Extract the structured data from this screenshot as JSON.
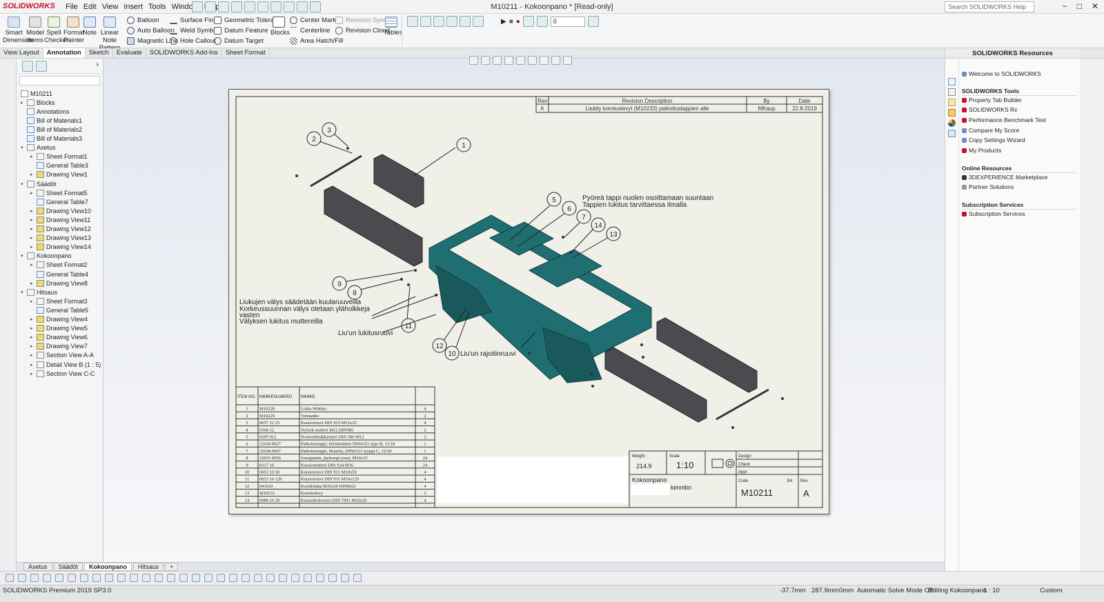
{
  "app": {
    "logo": "SOLIDWORKS",
    "menu": [
      "File",
      "Edit",
      "View",
      "Insert",
      "Tools",
      "Window",
      "Help"
    ],
    "title": "M10211 - Kokoonpano * [Read-only]",
    "search_placeholder": "Search SOLIDWORKS Help",
    "window_buttons": [
      "−",
      "□",
      "✕"
    ]
  },
  "ribbon": {
    "big": [
      {
        "label": "Smart Dimension",
        "icon": "smart-dimension-icon"
      },
      {
        "label": "Model Items",
        "icon": "model-items-icon"
      },
      {
        "label": "Spell Checker",
        "icon": "spell-checker-icon"
      },
      {
        "label": "Format Painter",
        "icon": "format-painter-icon"
      },
      {
        "label": "Note",
        "icon": "note-icon"
      },
      {
        "label": "Linear Note Pattern",
        "icon": "linear-note-pattern-icon"
      }
    ],
    "col1": [
      "Balloon",
      "Auto Balloon",
      "Magnetic Line"
    ],
    "col2": [
      "Surface Finish",
      "Weld Symbol",
      "Hole Callout"
    ],
    "col3": [
      "Geometric Tolerance",
      "Datum Feature",
      "Datum Target"
    ],
    "blocks": "Blocks",
    "col4": [
      "Center Mark",
      "Centerline",
      "Area Hatch/Fill"
    ],
    "col5": [
      "Revision Symbol",
      "Revision Cloud"
    ],
    "tables": "Tables",
    "layer_value": "0"
  },
  "tabs": [
    "View Layout",
    "Annotation",
    "Sketch",
    "Evaluate",
    "SOLIDWORKS Add-Ins",
    "Sheet Format"
  ],
  "active_tab": "Annotation",
  "tree": {
    "root": "M10211",
    "items": [
      {
        "label": "Blocks",
        "level": 1,
        "exp": "▸",
        "kind": "fold"
      },
      {
        "label": "Annotations",
        "level": 1,
        "exp": "",
        "kind": "ann"
      },
      {
        "label": "Bill of Materials1",
        "level": 1,
        "exp": "",
        "kind": "tbl"
      },
      {
        "label": "Bill of Materials2",
        "level": 1,
        "exp": "",
        "kind": "tbl"
      },
      {
        "label": "Bill of Materials3",
        "level": 1,
        "exp": "",
        "kind": "tbl"
      },
      {
        "label": "Asetus",
        "level": 1,
        "exp": "▾",
        "kind": "fold"
      },
      {
        "label": "Sheet Format1",
        "level": 2,
        "exp": "▸",
        "kind": "fold"
      },
      {
        "label": "General Table3",
        "level": 2,
        "exp": "",
        "kind": "tbl"
      },
      {
        "label": "Drawing View1",
        "level": 2,
        "exp": "▸",
        "kind": "view"
      },
      {
        "label": "Säädöt",
        "level": 1,
        "exp": "▾",
        "kind": "fold"
      },
      {
        "label": "Sheet Format5",
        "level": 2,
        "exp": "▸",
        "kind": "fold"
      },
      {
        "label": "General Table7",
        "level": 2,
        "exp": "",
        "kind": "tbl"
      },
      {
        "label": "Drawing View10",
        "level": 2,
        "exp": "▸",
        "kind": "view"
      },
      {
        "label": "Drawing View11",
        "level": 2,
        "exp": "▸",
        "kind": "view"
      },
      {
        "label": "Drawing View12",
        "level": 2,
        "exp": "▸",
        "kind": "view"
      },
      {
        "label": "Drawing View13",
        "level": 2,
        "exp": "▸",
        "kind": "view"
      },
      {
        "label": "Drawing View14",
        "level": 2,
        "exp": "▸",
        "kind": "view"
      },
      {
        "label": "Kokoonpano",
        "level": 1,
        "exp": "▾",
        "kind": "fold"
      },
      {
        "label": "Sheet Format2",
        "level": 2,
        "exp": "▸",
        "kind": "fold"
      },
      {
        "label": "General Table4",
        "level": 2,
        "exp": "",
        "kind": "tbl"
      },
      {
        "label": "Drawing View8",
        "level": 2,
        "exp": "▸",
        "kind": "view"
      },
      {
        "label": "Hitsaus",
        "level": 1,
        "exp": "▾",
        "kind": "fold"
      },
      {
        "label": "Sheet Format3",
        "level": 2,
        "exp": "▸",
        "kind": "fold"
      },
      {
        "label": "General Table5",
        "level": 2,
        "exp": "",
        "kind": "tbl"
      },
      {
        "label": "Drawing View4",
        "level": 2,
        "exp": "▸",
        "kind": "view"
      },
      {
        "label": "Drawing View5",
        "level": 2,
        "exp": "▸",
        "kind": "view"
      },
      {
        "label": "Drawing View6",
        "level": 2,
        "exp": "▸",
        "kind": "view"
      },
      {
        "label": "Drawing View7",
        "level": 2,
        "exp": "▸",
        "kind": "view"
      },
      {
        "label": "Section View A-A",
        "level": 2,
        "exp": "▸",
        "kind": "fold"
      },
      {
        "label": "Detail View B (1 : 5)",
        "level": 2,
        "exp": "▸",
        "kind": "fold"
      },
      {
        "label": "Section View C-C",
        "level": 2,
        "exp": "▸",
        "kind": "fold"
      }
    ]
  },
  "revision": {
    "headers": [
      "Rev",
      "Revision Description",
      "By",
      "Date"
    ],
    "row": [
      "A",
      "Lisätty korotuslevyt (M10233) paikoitustappien alle",
      "MKaup",
      "22.8.2019"
    ]
  },
  "notes": {
    "note1": [
      "Pyöreä tappi nuolen osoittamaan suuntaan",
      "Tappien lukitus tarvittaessa ilmalla"
    ],
    "note2": [
      "Liukujen välys säädetään kuularuuveilla",
      "Korkeussuunnan välys otetaan yläholkkeja",
      "vasten",
      "Välyksen lukitus muttereilla"
    ],
    "note3": "Liu'un lukitusruuvi",
    "note4": "Liu'un rajoitinruuvi"
  },
  "balloons": [
    "1",
    "2",
    "3",
    "5",
    "6",
    "7",
    "14",
    "13",
    "9",
    "8",
    "11",
    "12",
    "10"
  ],
  "bom": {
    "headers": [
      "ITEM NO.",
      "NIMIKENUMERO",
      "NIMIKE",
      ""
    ],
    "rows": [
      [
        "1",
        "M10228",
        "Liuku 900mm",
        "4"
      ],
      [
        "2",
        "M10229",
        "Vetotanko",
        "2"
      ],
      [
        "3",
        "0057 12 25",
        "Kuusioruuvi DIN 933 M12x25",
        "4"
      ],
      [
        "4",
        "0368 12",
        "Nylock mutteri M12 DIN985",
        "2"
      ],
      [
        "5",
        "0295 912",
        "Nostosilmukkaruuvi DIN 580 M12",
        "2"
      ],
      [
        "6",
        "22630.0027",
        "Paikoitustappi, lieriömäinen DIN6321 type B, 12/18",
        "1"
      ],
      [
        "7",
        "22630.0047",
        "Paikoitustappi, litistetty, DIN6321 tyyppi C, 12/18",
        "1"
      ],
      [
        "8",
        "22031.0056",
        "Jousipainin, jäykempi jousi, M16x33",
        "24"
      ],
      [
        "9",
        "0317 16",
        "Kuusiomutteri DIN 934 M16",
        "24"
      ],
      [
        "10",
        "0053 10 50",
        "Kuusioruuvi DIN 931 M10x50",
        "4"
      ],
      [
        "11",
        "0053 16 120",
        "Kuusioruuvi DIN 931 M16x120",
        "4"
      ],
      [
        "12",
        "041610",
        "Koriälslatta M10x30 DIN9021",
        "4"
      ],
      [
        "13",
        "M10233",
        "Korotuslevy",
        "2"
      ],
      [
        "14",
        "0089 10 20",
        "Kuusiokoloruuvi DIN 7991 M10x20",
        "4"
      ]
    ]
  },
  "titleblock": {
    "weight_label": "Weight",
    "weight": "214.9",
    "scale_label": "Scale",
    "scale": "1:10",
    "design": "Design",
    "check": "Check",
    "appr": "Appr",
    "name": "Kokoonpano",
    "name2": "kiinnitin",
    "sheet": "3/4",
    "code_label": "Code",
    "code": "M10211",
    "rev_label": "Rev",
    "rev": "A"
  },
  "resources": {
    "title": "SOLIDWORKS Resources",
    "welcome": "Welcome to SOLIDWORKS",
    "tools_title": "SOLIDWORKS Tools",
    "tools": [
      "Property Tab Builder",
      "SOLIDWORKS Rx",
      "Performance Benchmark Test",
      "Compare My Score",
      "Copy Settings Wizard",
      "My Products"
    ],
    "online_title": "Online Resources",
    "online": [
      "3DEXPERIENCE Marketplace",
      "Partner Solutions"
    ],
    "sub_title": "Subscription Services",
    "sub": [
      "Subscription Services"
    ]
  },
  "sheet_tabs": [
    "Asetus",
    "Säädöt",
    "Kokoonpano",
    "Hitsaus"
  ],
  "active_sheet": "Kokoonpano",
  "status": {
    "version": "SOLIDWORKS Premium 2019 SP3.0",
    "x": "-37.7mm",
    "y": "287.9mm",
    "z": "0mm",
    "solve": "Automatic Solve Mode Off",
    "editing": "Editing Kokoonpano",
    "scale": "1 : 10",
    "units": "Custom"
  },
  "colors": {
    "frame": "#1f6e72",
    "frame_dark": "#134a4d",
    "slide": "#4a4b4e",
    "accent": "#c8102e"
  }
}
